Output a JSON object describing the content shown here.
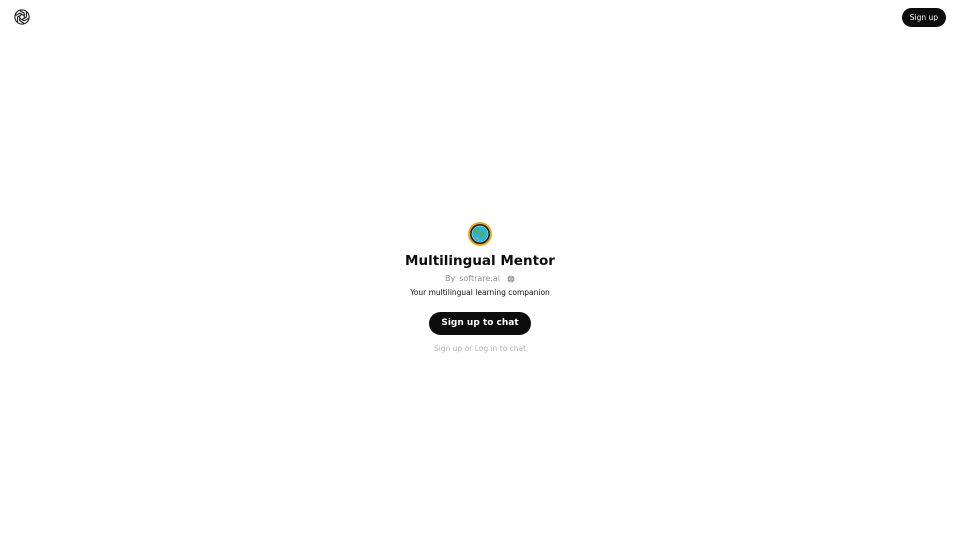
{
  "header": {
    "logo_icon": "openai-logo-icon",
    "signup_label": "Sign up"
  },
  "gpt": {
    "avatar_icon": "globe-avatar-icon",
    "name": "Multilingual Mentor",
    "by_prefix": "By",
    "author": "softrare.ai",
    "author_icon": "globe-icon",
    "description": "Your multilingual learning companion"
  },
  "cta": {
    "label": "Sign up to chat"
  },
  "footer_prompt": {
    "signup_link": "Sign up",
    "or_text": "or",
    "login_link": "Log in",
    "suffix": "to chat"
  },
  "colors": {
    "button_bg": "#0d0d0d",
    "button_text": "#ffffff",
    "muted_text": "#8e8e8e",
    "faint_text": "#b4b4b4"
  }
}
